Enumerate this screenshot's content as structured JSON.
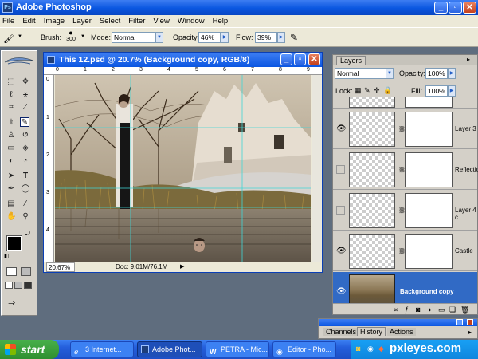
{
  "window": {
    "title": "Adobe Photoshop",
    "app_icon": "Ps"
  },
  "menu": [
    "File",
    "Edit",
    "Image",
    "Layer",
    "Select",
    "Filter",
    "View",
    "Window",
    "Help"
  ],
  "options": {
    "brush_label": "Brush:",
    "brush_size": "300",
    "mode_label": "Mode:",
    "mode_value": "Normal",
    "opacity_label": "Opacity:",
    "opacity_value": "46%",
    "flow_label": "Flow:",
    "flow_value": "39%"
  },
  "document": {
    "title": "This 12.psd @ 20.7% (Background copy, RGB/8)",
    "zoom": "20.67%",
    "doc_info": "Doc: 9.01M/76.1M",
    "ruler_marks": [
      "0",
      "1",
      "2",
      "3",
      "4",
      "5",
      "6",
      "7",
      "8",
      "9"
    ],
    "side_ruler_marks": [
      "0",
      "1",
      "2",
      "3",
      "4"
    ]
  },
  "layers_panel": {
    "tab": "Layers",
    "blend_mode": "Normal",
    "opacity_label": "Opacity:",
    "opacity_value": "100%",
    "lock_label": "Lock:",
    "fill_label": "Fill:",
    "fill_value": "100%",
    "layers": [
      {
        "name": "Layer 3",
        "visible": true,
        "selected": false
      },
      {
        "name": "Reflectio",
        "visible": false,
        "selected": false
      },
      {
        "name": "Layer 4 c",
        "visible": false,
        "selected": false
      },
      {
        "name": "Castle",
        "visible": true,
        "selected": false
      },
      {
        "name": "Background copy",
        "visible": true,
        "selected": true
      }
    ]
  },
  "bottom_panel": {
    "tabs": [
      "Channels",
      "History",
      "Actions"
    ]
  },
  "taskbar": {
    "start": "start",
    "tasks": [
      "3 Internet...",
      "Adobe Phot...",
      "PETRA - Mic...",
      "Editor - Pho..."
    ],
    "tray_text": "pxleyes.com"
  },
  "colors": {
    "xp_blue": "#0a56e0",
    "selection": "#316ac5",
    "panel_bg": "#d4d0c8",
    "desktop": "#5f6d7e"
  }
}
